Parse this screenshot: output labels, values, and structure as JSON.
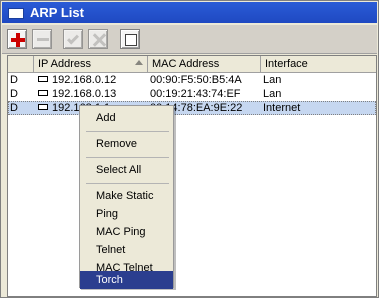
{
  "window": {
    "title": "ARP List"
  },
  "toolbar": {
    "buttons": [
      {
        "name": "add-button",
        "icon": "plus-icon",
        "enabled": true
      },
      {
        "name": "remove-button",
        "icon": "minus-icon",
        "enabled": false
      },
      {
        "name": "enable-button",
        "icon": "check-icon",
        "enabled": false
      },
      {
        "name": "disable-button",
        "icon": "x-icon",
        "enabled": false
      },
      {
        "name": "comment-button",
        "icon": "comment-icon",
        "enabled": true
      }
    ]
  },
  "table": {
    "columns": [
      "IP Address",
      "MAC Address",
      "Interface"
    ],
    "rows": [
      {
        "flag": "D",
        "ip": "192.168.0.12",
        "mac": "00:90:F5:50:B5:4A",
        "iface": "Lan",
        "selected": false
      },
      {
        "flag": "D",
        "ip": "192.168.0.13",
        "mac": "00:19:21:43:74:EF",
        "iface": "Lan",
        "selected": false
      },
      {
        "flag": "D",
        "ip": "192.168.1.1",
        "mac": "00:14:78:EA:9E:22",
        "iface": "Internet",
        "selected": true
      }
    ]
  },
  "context_menu": {
    "items": [
      "Add",
      "Remove",
      "Select All",
      "Make Static",
      "Ping",
      "MAC Ping",
      "Telnet",
      "MAC Telnet",
      "Torch"
    ],
    "highlighted": "Torch"
  },
  "colors": {
    "titlebar": "#1f49c2",
    "selection": "#c6d7f0",
    "menu_highlight": "#2b3e8f"
  }
}
